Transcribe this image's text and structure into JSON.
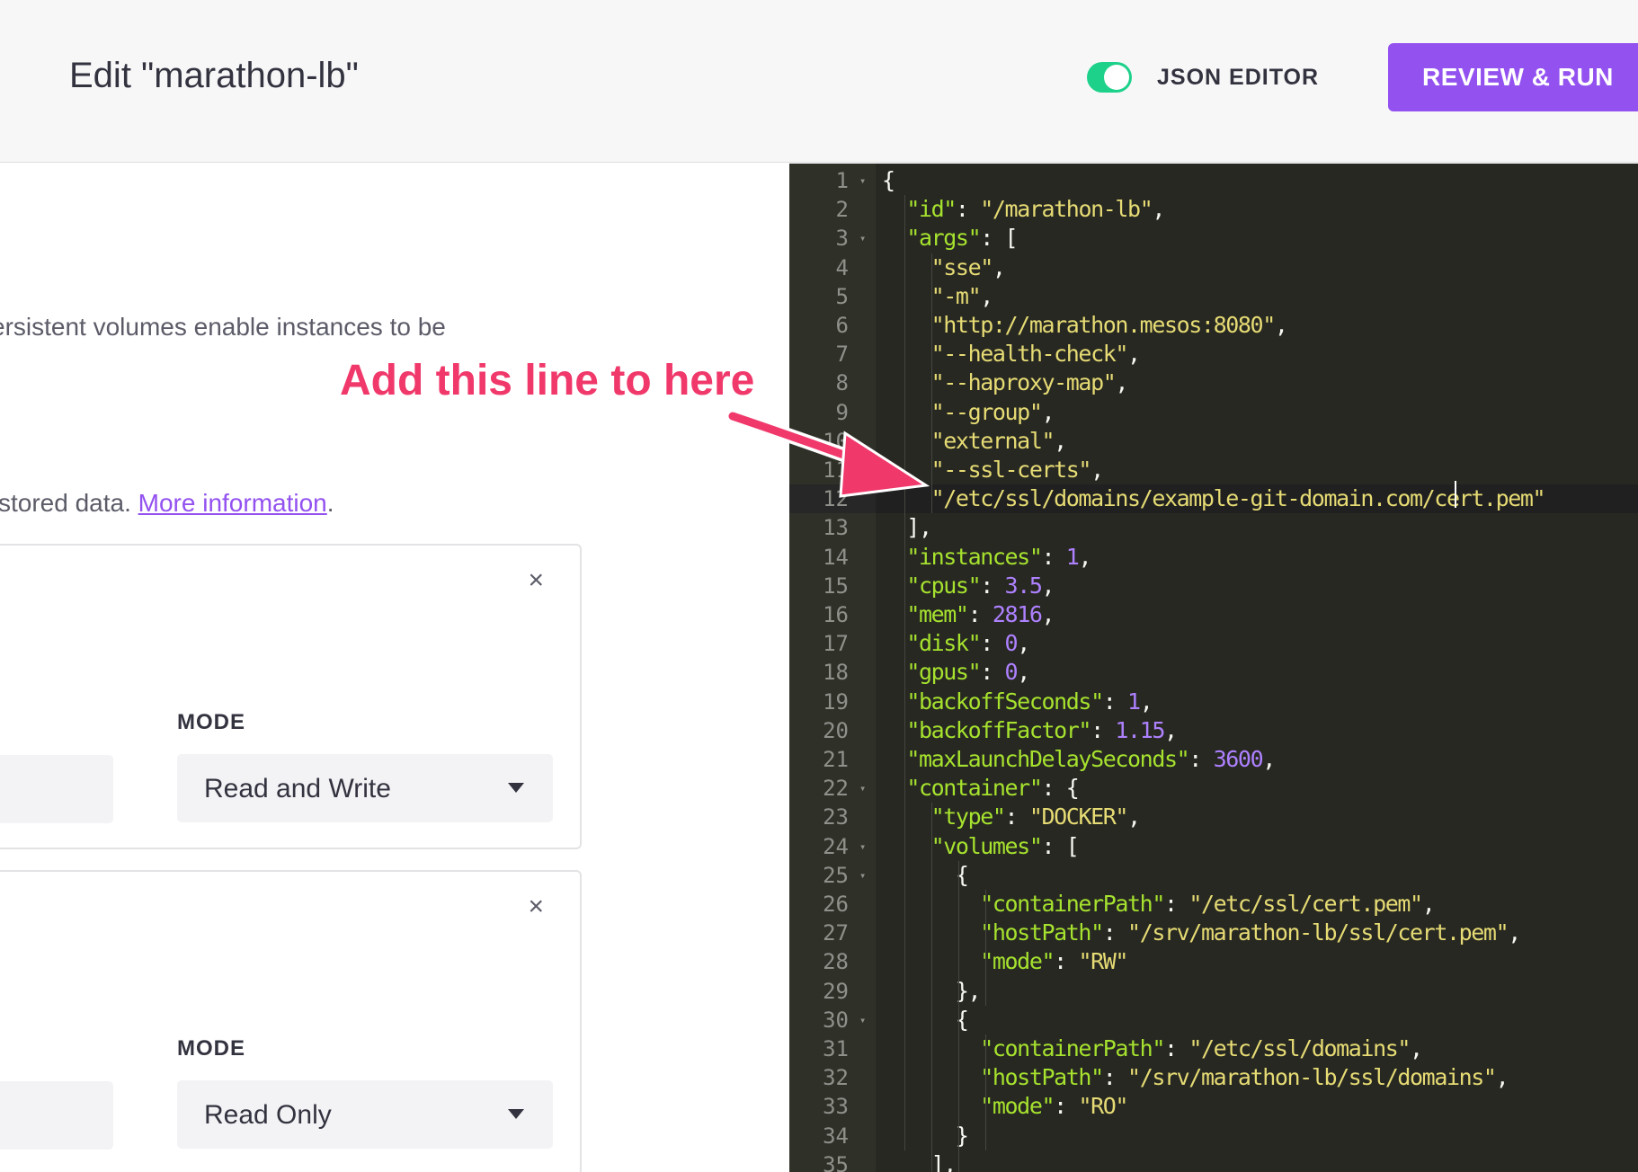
{
  "header": {
    "title": "Edit \"marathon-lb\"",
    "json_editor_label": "JSON EDITOR",
    "json_editor_enabled": true,
    "review_run_label": "REVIEW & RUN"
  },
  "left_panel": {
    "description_partial": "ersistent volumes enable instances to be",
    "description2_partial": "stored data. ",
    "more_info_link": "More information",
    "description2_end": ".",
    "volumes": [
      {
        "mode_label": "MODE",
        "mode_value": "Read and Write",
        "close_label": "×"
      },
      {
        "mode_label": "MODE",
        "mode_value": "Read Only",
        "close_label": "×"
      }
    ]
  },
  "annotation": {
    "text": "Add this line to here",
    "color": "#f0386b"
  },
  "editor": {
    "active_line": 12,
    "lines": [
      "{",
      "  \"id\": \"/marathon-lb\",",
      "  \"args\": [",
      "    \"sse\",",
      "    \"-m\",",
      "    \"http://marathon.mesos:8080\",",
      "    \"--health-check\",",
      "    \"--haproxy-map\",",
      "    \"--group\",",
      "    \"external\",",
      "    \"--ssl-certs\",",
      "    \"/etc/ssl/domains/example-git-domain.com/cert.pem\"",
      "  ],",
      "  \"instances\": 1,",
      "  \"cpus\": 3.5,",
      "  \"mem\": 2816,",
      "  \"disk\": 0,",
      "  \"gpus\": 0,",
      "  \"backoffSeconds\": 1,",
      "  \"backoffFactor\": 1.15,",
      "  \"maxLaunchDelaySeconds\": 3600,",
      "  \"container\": {",
      "    \"type\": \"DOCKER\",",
      "    \"volumes\": [",
      "      {",
      "        \"containerPath\": \"/etc/ssl/cert.pem\",",
      "        \"hostPath\": \"/srv/marathon-lb/ssl/cert.pem\",",
      "        \"mode\": \"RW\"",
      "      },",
      "      {",
      "        \"containerPath\": \"/etc/ssl/domains\",",
      "        \"hostPath\": \"/srv/marathon-lb/ssl/domains\",",
      "        \"mode\": \"RO\"",
      "      }",
      "    ],"
    ],
    "fold_lines": [
      1,
      3,
      22,
      24,
      25,
      30
    ]
  },
  "colors": {
    "accent": "#9351f0",
    "toggle_on": "#1ed18b",
    "editor_bg": "#272822",
    "json_key": "#a6e22e",
    "json_string": "#e6db74",
    "json_number": "#ae81ff"
  }
}
